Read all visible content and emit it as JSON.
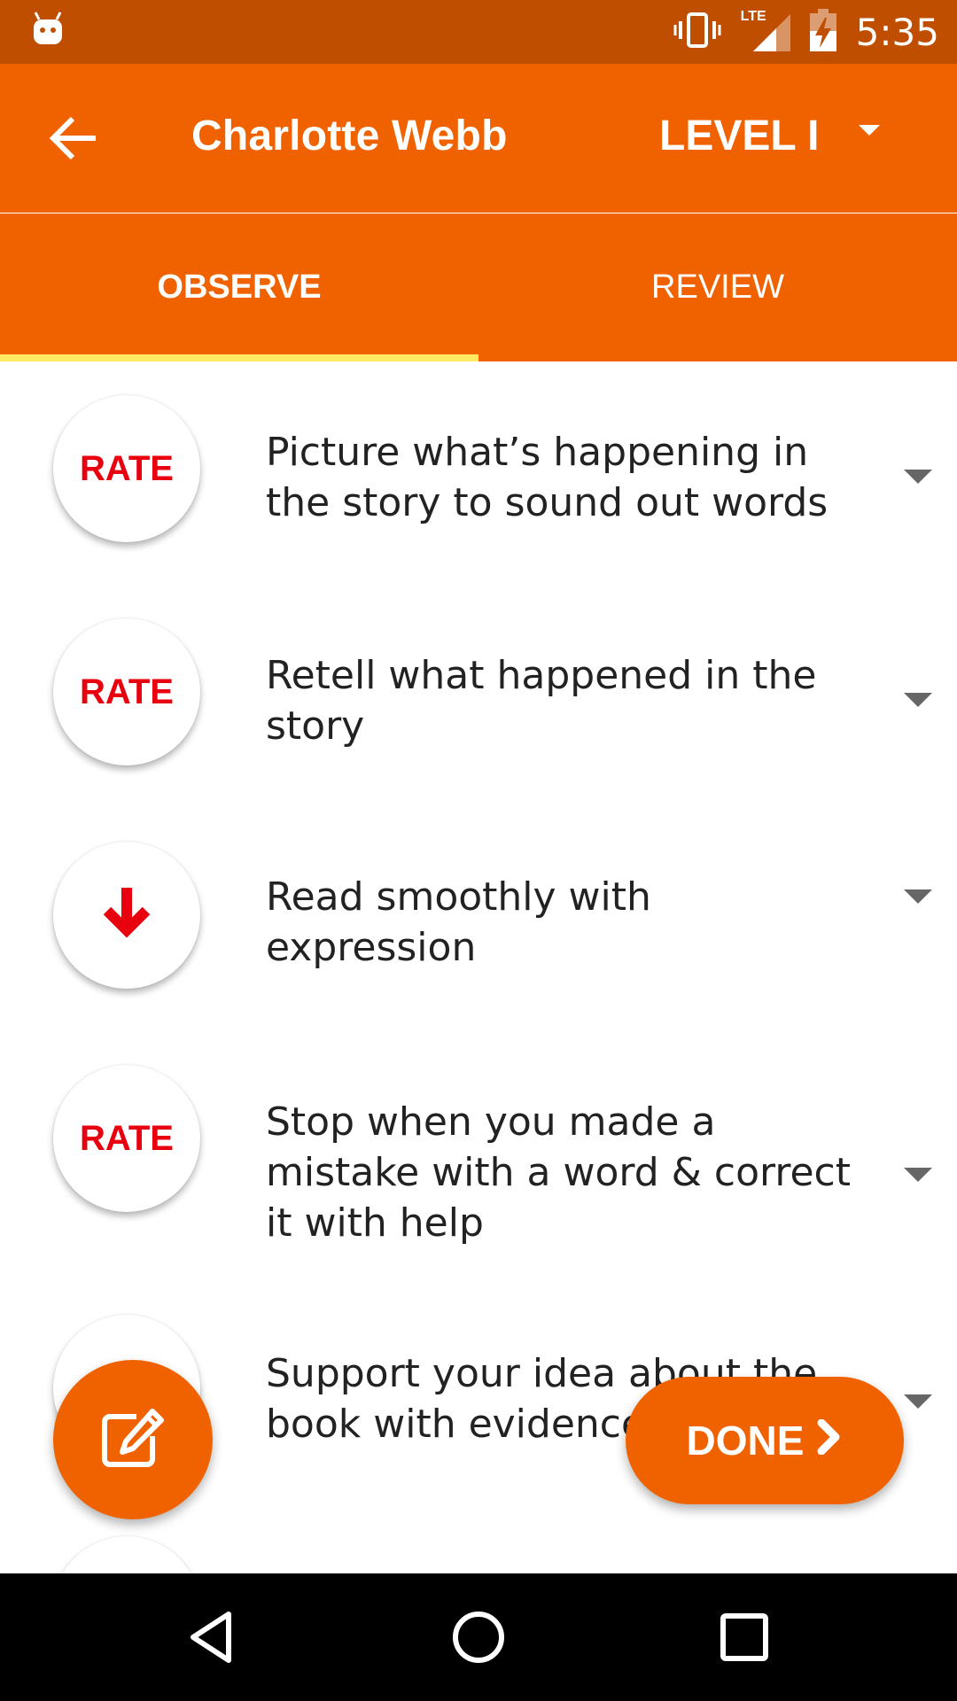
{
  "status_bar": {
    "time": "5:35",
    "icons": [
      "android-icon",
      "vibrate-icon",
      "lte-signal-icon",
      "battery-charging-icon"
    ],
    "lte_label": "LTE"
  },
  "app_bar": {
    "title": "Charlotte Webb",
    "level": "LEVEL I",
    "back_icon": "arrow-left-icon"
  },
  "tabs": [
    {
      "label": "OBSERVE",
      "active": true
    },
    {
      "label": "REVIEW",
      "active": false
    }
  ],
  "items": [
    {
      "button": "RATE",
      "text": "Picture what’s happening in the story to sound out words"
    },
    {
      "button": "RATE",
      "text": "Retell what happened in the story"
    },
    {
      "button": "",
      "button_icon": "arrow-down-icon",
      "text": "Read smoothly with expression"
    },
    {
      "button": "RATE",
      "text": "Stop when you made a mistake with a word & correct it with help"
    },
    {
      "button": "",
      "text": "Support your idea about the book with evidence"
    }
  ],
  "fab": {
    "icon": "edit-icon"
  },
  "done_button": {
    "label": "DONE",
    "icon": "chevron-right-icon"
  },
  "colors": {
    "status_bar": "#c04e00",
    "primary": "#f06200",
    "tab_indicator": "#ffea63",
    "rate_text": "#e8000e"
  }
}
